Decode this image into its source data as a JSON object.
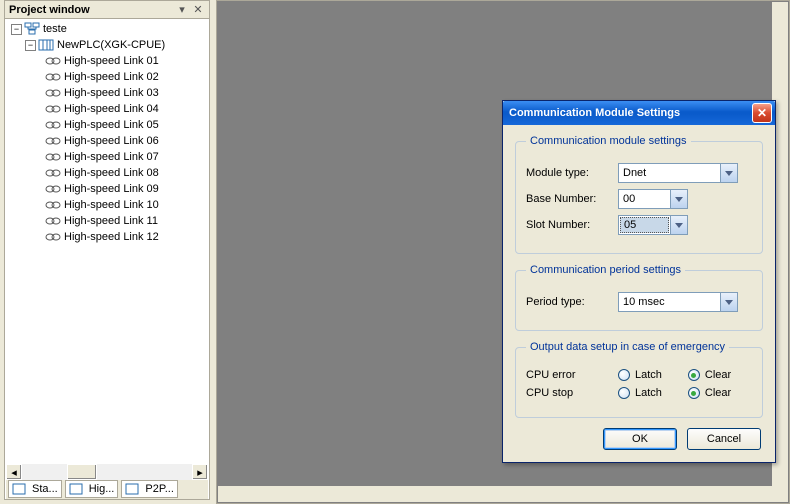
{
  "panel": {
    "title": "Project window"
  },
  "tree": {
    "root": "teste",
    "plc": "NewPLC(XGK-CPUE)",
    "links": [
      "High-speed Link 01",
      "High-speed Link 02",
      "High-speed Link 03",
      "High-speed Link 04",
      "High-speed Link 05",
      "High-speed Link 06",
      "High-speed Link 07",
      "High-speed Link 08",
      "High-speed Link 09",
      "High-speed Link 10",
      "High-speed Link 11",
      "High-speed Link 12"
    ]
  },
  "tabs": [
    {
      "label": "Sta..."
    },
    {
      "label": "Hig..."
    },
    {
      "label": "P2P..."
    }
  ],
  "dialog": {
    "title": "Communication Module Settings",
    "group1": {
      "legend": "Communication module settings",
      "module_type_label": "Module type:",
      "module_type_value": "Dnet",
      "base_number_label": "Base Number:",
      "base_number_value": "00",
      "slot_number_label": "Slot Number:",
      "slot_number_value": "05"
    },
    "group2": {
      "legend": "Communication period settings",
      "period_type_label": "Period type:",
      "period_type_value": "10 msec"
    },
    "group3": {
      "legend": "Output data setup in case of emergency",
      "cpu_error_label": "CPU error",
      "cpu_stop_label": "CPU stop",
      "latch_label": "Latch",
      "clear_label": "Clear",
      "cpu_error_value": "Clear",
      "cpu_stop_value": "Clear"
    },
    "ok": "OK",
    "cancel": "Cancel"
  }
}
